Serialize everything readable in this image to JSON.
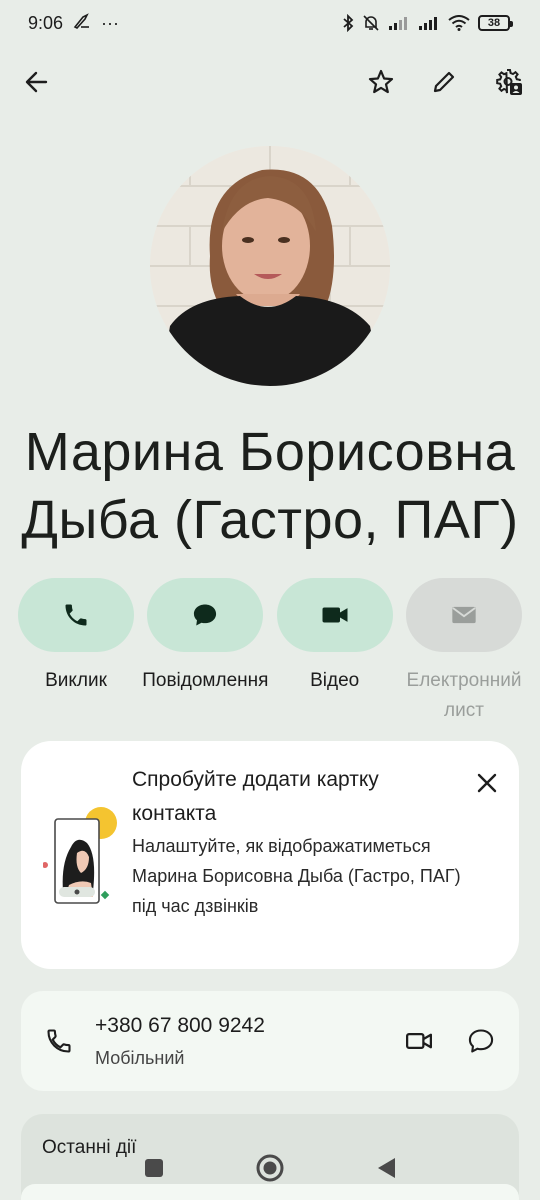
{
  "status_bar": {
    "time": "9:06",
    "more": "···",
    "battery": "38"
  },
  "toolbar": {
    "back_icon": "arrow-back-icon",
    "star_icon": "star-outline-icon",
    "edit_icon": "pencil-icon",
    "settings_icon": "contact-settings-icon"
  },
  "contact": {
    "name": "Марина Борисовна Дыба (Гастро, ПАГ)"
  },
  "actions": [
    {
      "label": "Виклик",
      "icon": "phone-icon",
      "enabled": true
    },
    {
      "label": "Повідомлення",
      "icon": "message-icon",
      "enabled": true
    },
    {
      "label": "Відео",
      "icon": "videocam-icon",
      "enabled": true
    },
    {
      "label": "Електронний лист",
      "icon": "email-icon",
      "enabled": false
    }
  ],
  "suggestion": {
    "title": "Спробуйте додати картку контакта",
    "body": "Налаштуйте, як відображатиметься Марина Борисовна Дыба (Гастро, ПАГ) під час дзвінків"
  },
  "phone": {
    "number": "+380 67 800 9242",
    "type": "Мобільний"
  },
  "recent": {
    "title": "Останні дії"
  },
  "colors": {
    "background": "#e8ede8",
    "action_pill": "#c8e6d6",
    "action_pill_disabled": "#d7dad7",
    "card": "#ffffff"
  }
}
